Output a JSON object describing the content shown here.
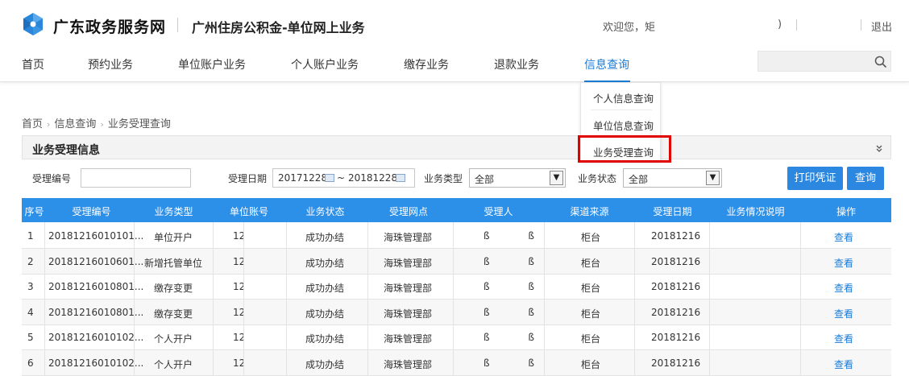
{
  "header": {
    "brand": "广东政务服务网",
    "subbrand": "广州住房公积金-单位网上业务",
    "welcome": "欢迎您，矩",
    "paren": ")",
    "logout": "退出"
  },
  "nav": {
    "items": [
      "首页",
      "预约业务",
      "单位账户业务",
      "个人账户业务",
      "缴存业务",
      "退款业务",
      "信息查询"
    ],
    "active_index": 6,
    "search_placeholder": ""
  },
  "dropdown": {
    "items": [
      "个人信息查询",
      "单位信息查询",
      "业务受理查询"
    ],
    "highlighted_index": 2
  },
  "breadcrumb": [
    "首页",
    "信息查询",
    "业务受理查询"
  ],
  "panel": {
    "title": "业务受理信息"
  },
  "filters": {
    "accept_no_label": "受理编号",
    "accept_no_value": "",
    "date_label": "受理日期",
    "date_from": "20171228",
    "date_sep": "~",
    "date_to": "20181228",
    "type_label": "业务类型",
    "type_value": "全部",
    "status_label": "业务状态",
    "status_value": "全部",
    "print_button": "打印凭证",
    "query_button": "查询"
  },
  "table": {
    "headers": [
      "序号",
      "受理编号",
      "业务类型",
      "单位账号",
      "业务状态",
      "受理网点",
      "受理人",
      "渠道来源",
      "受理日期",
      "业务情况说明",
      "操作"
    ],
    "rows": [
      {
        "no": "1",
        "id": "20181216010101...",
        "type": "单位开户",
        "account": "12",
        "status": "成功办结",
        "branch": "海珠管理部",
        "handler": "ß ß",
        "channel": "柜台",
        "date": "20181216",
        "note": "",
        "op": "查看"
      },
      {
        "no": "2",
        "id": "20181216010601...",
        "type": "新增托管单位",
        "account": "12",
        "status": "成功办结",
        "branch": "海珠管理部",
        "handler": "ß ß",
        "channel": "柜台",
        "date": "20181216",
        "note": "",
        "op": "查看"
      },
      {
        "no": "3",
        "id": "20181216010801...",
        "type": "缴存变更",
        "account": "12",
        "status": "成功办结",
        "branch": "海珠管理部",
        "handler": "ß ß",
        "channel": "柜台",
        "date": "20181216",
        "note": "",
        "op": "查看"
      },
      {
        "no": "4",
        "id": "20181216010801...",
        "type": "缴存变更",
        "account": "12",
        "status": "成功办结",
        "branch": "海珠管理部",
        "handler": "ß ß",
        "channel": "柜台",
        "date": "20181216",
        "note": "",
        "op": "查看"
      },
      {
        "no": "5",
        "id": "20181216010102...",
        "type": "个人开户",
        "account": "12",
        "status": "成功办结",
        "branch": "海珠管理部",
        "handler": "ß ß",
        "channel": "柜台",
        "date": "20181216",
        "note": "",
        "op": "查看"
      },
      {
        "no": "6",
        "id": "20181216010102...",
        "type": "个人开户",
        "account": "12",
        "status": "成功办结",
        "branch": "海珠管理部",
        "handler": "ß ß",
        "channel": "柜台",
        "date": "20181216",
        "note": "",
        "op": "查看"
      }
    ]
  },
  "colors": {
    "accent": "#1a7bd7",
    "table_header": "#2c8fe8",
    "button": "#2b87e0",
    "highlight": "#e00000"
  }
}
